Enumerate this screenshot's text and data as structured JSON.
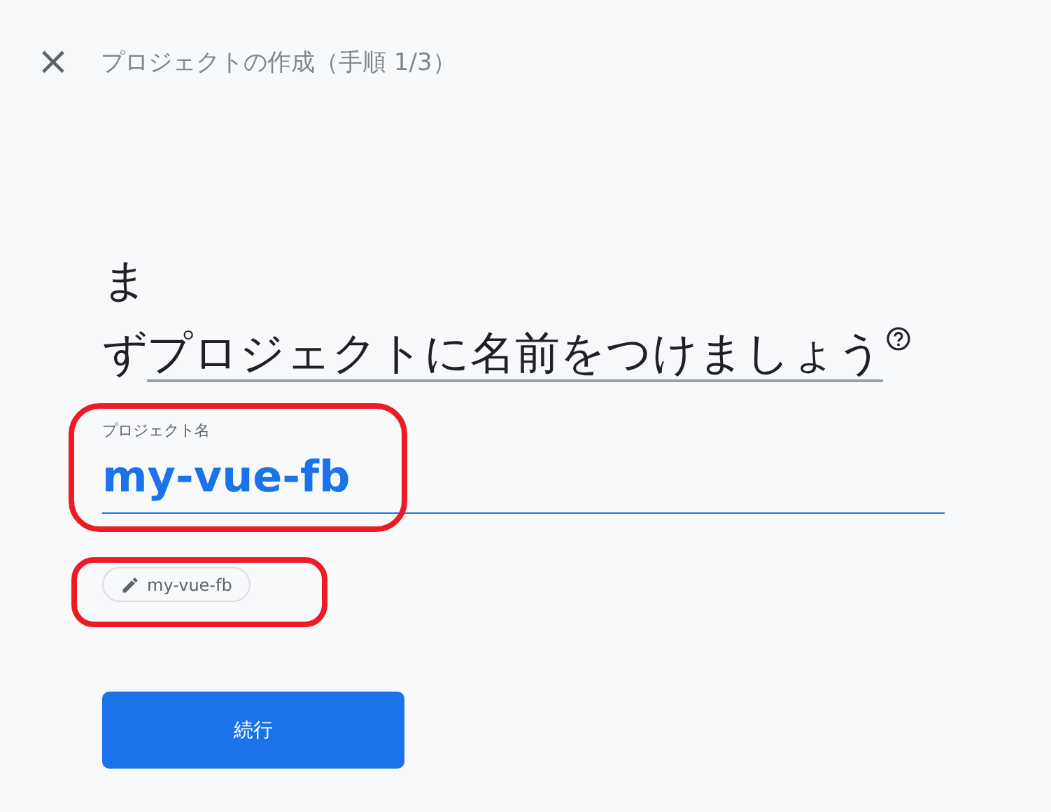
{
  "header": {
    "close": "×",
    "title": "プロジェクトの作成（手順 1/3）"
  },
  "heading": {
    "prefix": "まず",
    "link": "プロジェクトに名前をつけましょう"
  },
  "project_name_field": {
    "label": "プロジェクト名",
    "value": "my-vue-fb"
  },
  "project_id_chip": {
    "label": "my-vue-fb"
  },
  "continue_button": {
    "label": "続行"
  }
}
